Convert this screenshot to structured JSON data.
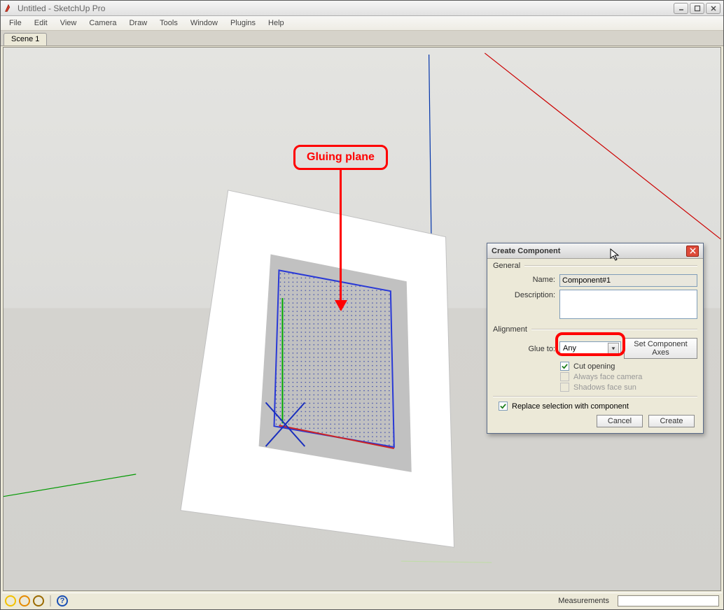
{
  "window": {
    "title": "Untitled - SketchUp Pro"
  },
  "menubar": [
    "File",
    "Edit",
    "View",
    "Camera",
    "Draw",
    "Tools",
    "Window",
    "Plugins",
    "Help"
  ],
  "scene_tabs": [
    "Scene 1"
  ],
  "callout": {
    "label": "Gluing plane"
  },
  "dialog": {
    "title": "Create Component",
    "general_label": "General",
    "name_label": "Name:",
    "name_value": "Component#1",
    "description_label": "Description:",
    "description_value": "",
    "alignment_label": "Alignment",
    "glue_to_label": "Glue to:",
    "glue_to_value": "Any",
    "set_axes_label": "Set Component Axes",
    "cut_opening_label": "Cut opening",
    "cut_opening_checked": true,
    "always_face_label": "Always face camera",
    "always_face_checked": false,
    "shadows_face_label": "Shadows face sun",
    "shadows_face_checked": false,
    "replace_label": "Replace selection with component",
    "replace_checked": true,
    "cancel_label": "Cancel",
    "create_label": "Create"
  },
  "statusbar": {
    "measurements_label": "Measurements"
  },
  "colors": {
    "accent_red": "#ff0000",
    "axis_blue": "#0033aa",
    "axis_red": "#cc0000",
    "axis_green": "#009900",
    "face_fill": "#c9cfe8",
    "face_border": "#2939d6",
    "panel_bg": "#ece9d8"
  }
}
